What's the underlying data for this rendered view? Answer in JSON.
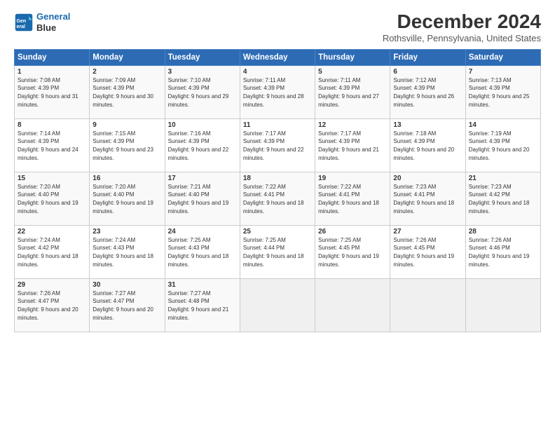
{
  "logo": {
    "line1": "General",
    "line2": "Blue"
  },
  "title": "December 2024",
  "subtitle": "Rothsville, Pennsylvania, United States",
  "headers": [
    "Sunday",
    "Monday",
    "Tuesday",
    "Wednesday",
    "Thursday",
    "Friday",
    "Saturday"
  ],
  "weeks": [
    [
      {
        "day": "1",
        "sunrise": "7:08 AM",
        "sunset": "4:39 PM",
        "daylight": "9 hours and 31 minutes."
      },
      {
        "day": "2",
        "sunrise": "7:09 AM",
        "sunset": "4:39 PM",
        "daylight": "9 hours and 30 minutes."
      },
      {
        "day": "3",
        "sunrise": "7:10 AM",
        "sunset": "4:39 PM",
        "daylight": "9 hours and 29 minutes."
      },
      {
        "day": "4",
        "sunrise": "7:11 AM",
        "sunset": "4:39 PM",
        "daylight": "9 hours and 28 minutes."
      },
      {
        "day": "5",
        "sunrise": "7:11 AM",
        "sunset": "4:39 PM",
        "daylight": "9 hours and 27 minutes."
      },
      {
        "day": "6",
        "sunrise": "7:12 AM",
        "sunset": "4:39 PM",
        "daylight": "9 hours and 26 minutes."
      },
      {
        "day": "7",
        "sunrise": "7:13 AM",
        "sunset": "4:39 PM",
        "daylight": "9 hours and 25 minutes."
      }
    ],
    [
      {
        "day": "8",
        "sunrise": "7:14 AM",
        "sunset": "4:39 PM",
        "daylight": "9 hours and 24 minutes."
      },
      {
        "day": "9",
        "sunrise": "7:15 AM",
        "sunset": "4:39 PM",
        "daylight": "9 hours and 23 minutes."
      },
      {
        "day": "10",
        "sunrise": "7:16 AM",
        "sunset": "4:39 PM",
        "daylight": "9 hours and 22 minutes."
      },
      {
        "day": "11",
        "sunrise": "7:17 AM",
        "sunset": "4:39 PM",
        "daylight": "9 hours and 22 minutes."
      },
      {
        "day": "12",
        "sunrise": "7:17 AM",
        "sunset": "4:39 PM",
        "daylight": "9 hours and 21 minutes."
      },
      {
        "day": "13",
        "sunrise": "7:18 AM",
        "sunset": "4:39 PM",
        "daylight": "9 hours and 20 minutes."
      },
      {
        "day": "14",
        "sunrise": "7:19 AM",
        "sunset": "4:39 PM",
        "daylight": "9 hours and 20 minutes."
      }
    ],
    [
      {
        "day": "15",
        "sunrise": "7:20 AM",
        "sunset": "4:40 PM",
        "daylight": "9 hours and 19 minutes."
      },
      {
        "day": "16",
        "sunrise": "7:20 AM",
        "sunset": "4:40 PM",
        "daylight": "9 hours and 19 minutes."
      },
      {
        "day": "17",
        "sunrise": "7:21 AM",
        "sunset": "4:40 PM",
        "daylight": "9 hours and 19 minutes."
      },
      {
        "day": "18",
        "sunrise": "7:22 AM",
        "sunset": "4:41 PM",
        "daylight": "9 hours and 18 minutes."
      },
      {
        "day": "19",
        "sunrise": "7:22 AM",
        "sunset": "4:41 PM",
        "daylight": "9 hours and 18 minutes."
      },
      {
        "day": "20",
        "sunrise": "7:23 AM",
        "sunset": "4:41 PM",
        "daylight": "9 hours and 18 minutes."
      },
      {
        "day": "21",
        "sunrise": "7:23 AM",
        "sunset": "4:42 PM",
        "daylight": "9 hours and 18 minutes."
      }
    ],
    [
      {
        "day": "22",
        "sunrise": "7:24 AM",
        "sunset": "4:42 PM",
        "daylight": "9 hours and 18 minutes."
      },
      {
        "day": "23",
        "sunrise": "7:24 AM",
        "sunset": "4:43 PM",
        "daylight": "9 hours and 18 minutes."
      },
      {
        "day": "24",
        "sunrise": "7:25 AM",
        "sunset": "4:43 PM",
        "daylight": "9 hours and 18 minutes."
      },
      {
        "day": "25",
        "sunrise": "7:25 AM",
        "sunset": "4:44 PM",
        "daylight": "9 hours and 18 minutes."
      },
      {
        "day": "26",
        "sunrise": "7:25 AM",
        "sunset": "4:45 PM",
        "daylight": "9 hours and 19 minutes."
      },
      {
        "day": "27",
        "sunrise": "7:26 AM",
        "sunset": "4:45 PM",
        "daylight": "9 hours and 19 minutes."
      },
      {
        "day": "28",
        "sunrise": "7:26 AM",
        "sunset": "4:46 PM",
        "daylight": "9 hours and 19 minutes."
      }
    ],
    [
      {
        "day": "29",
        "sunrise": "7:26 AM",
        "sunset": "4:47 PM",
        "daylight": "9 hours and 20 minutes."
      },
      {
        "day": "30",
        "sunrise": "7:27 AM",
        "sunset": "4:47 PM",
        "daylight": "9 hours and 20 minutes."
      },
      {
        "day": "31",
        "sunrise": "7:27 AM",
        "sunset": "4:48 PM",
        "daylight": "9 hours and 21 minutes."
      },
      null,
      null,
      null,
      null
    ]
  ]
}
